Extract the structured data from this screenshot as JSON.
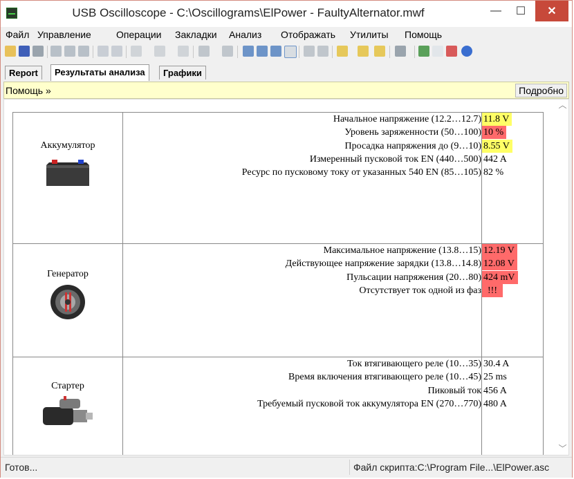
{
  "window": {
    "title": "USB Oscilloscope - C:\\Oscillograms\\ElPower - FaultyAlternator.mwf",
    "minimize_glyph": "—",
    "maximize_glyph": "☐",
    "close_glyph": "✕"
  },
  "menu": [
    "Файл",
    "Управление",
    "Операции",
    "Закладки",
    "Анализ",
    "Отображать",
    "Утилиты",
    "Помощь"
  ],
  "tabs": [
    {
      "label": "Report",
      "active": false
    },
    {
      "label": "Результаты анализа",
      "active": true
    },
    {
      "label": "Графики",
      "active": false
    }
  ],
  "help_bar": {
    "link": "Помощь »",
    "detail_button": "Подробно"
  },
  "colors": {
    "warning": "#ffff66",
    "fault": "#ff6a6a"
  },
  "report": [
    {
      "component": "Аккумулятор",
      "icon": "battery-icon",
      "rows": [
        {
          "label": "Начальное напряжение (12.2…12.7)",
          "value": "11.8 V",
          "status": "yellow"
        },
        {
          "label": "Уровень заряженности (50…100)",
          "value": "10 %",
          "status": "red"
        },
        {
          "label": "Просадка напряжения до (9…10)",
          "value": "8.55 V",
          "status": "yellow"
        },
        {
          "label": "Измеренный пусковой ток EN (440…500)",
          "value": "442 A",
          "status": "normal"
        },
        {
          "label": "Ресурс по пусковому току от указанных 540 EN (85…105)",
          "value": "82 %",
          "status": "normal"
        }
      ]
    },
    {
      "component": "Генератор",
      "icon": "alternator-icon",
      "rows": [
        {
          "label": "Максимальное напряжение (13.8…15)",
          "value": "12.19 V",
          "status": "red"
        },
        {
          "label": "Действующее напряжение зарядки (13.8…14.8)",
          "value": "12.08 V",
          "status": "red"
        },
        {
          "label": "Пульсации напряжения (20…80)",
          "value": "424 mV",
          "status": "red"
        },
        {
          "label": "Отсутствует ток одной из фаз",
          "value": "!!!",
          "status": "red"
        }
      ]
    },
    {
      "component": "Стартер",
      "icon": "starter-motor-icon",
      "rows": [
        {
          "label": "Ток втягивающего реле (10…35)",
          "value": "30.4 A",
          "status": "normal"
        },
        {
          "label": "Время включения втягивающего реле (10…45)",
          "value": "25 ms",
          "status": "normal"
        },
        {
          "label": "Пиковый ток",
          "value": "456 A",
          "status": "normal"
        },
        {
          "label": "Требуемый пусковой ток аккумулятора EN (270…770)",
          "value": "480 A",
          "status": "normal"
        }
      ]
    }
  ],
  "status": {
    "left": "Готов...",
    "right": "Файл скрипта:C:\\Program File...\\ElPower.asc"
  }
}
